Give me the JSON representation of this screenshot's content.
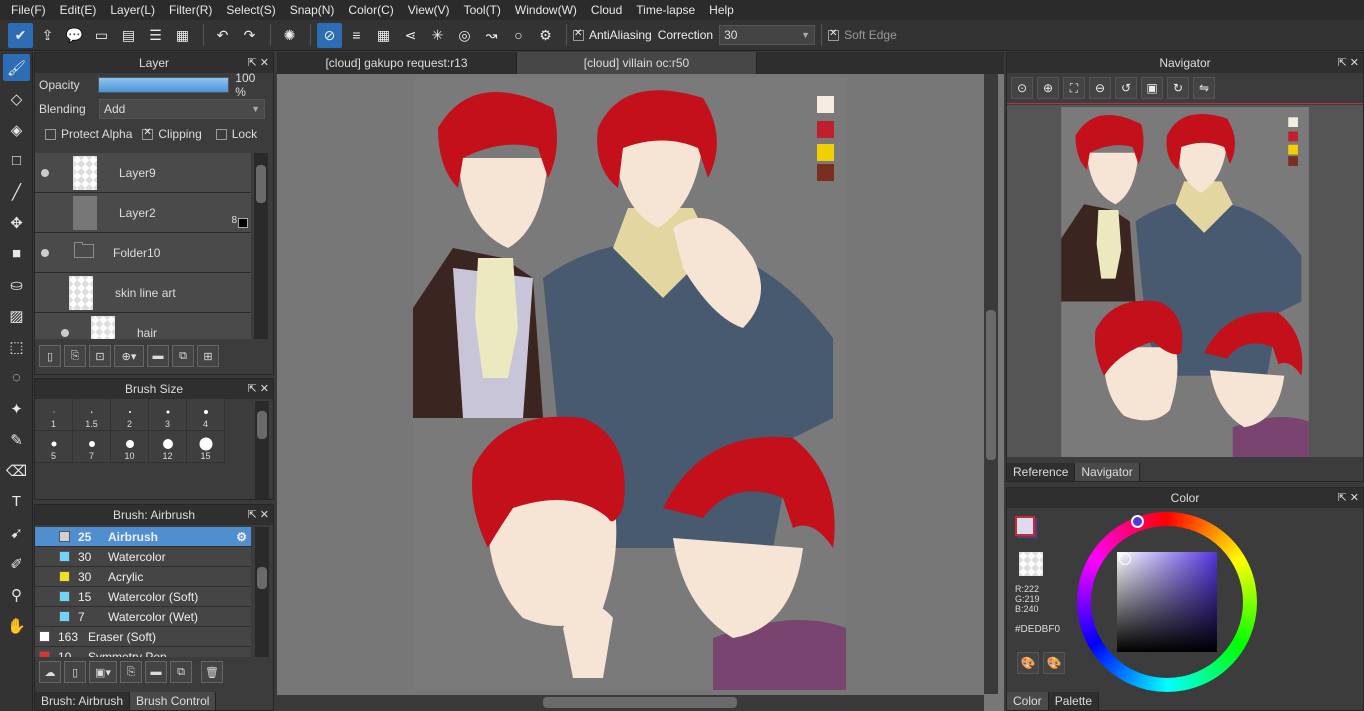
{
  "menu": [
    "File(F)",
    "Edit(E)",
    "Layer(L)",
    "Filter(R)",
    "Select(S)",
    "Snap(N)",
    "Color(C)",
    "View(V)",
    "Tool(T)",
    "Window(W)",
    "Cloud",
    "Time-lapse",
    "Help"
  ],
  "toolbar": {
    "antialiasing_label": "AntiAliasing",
    "correction_label": "Correction",
    "correction_value": "30",
    "soft_edge_label": "Soft Edge"
  },
  "layer_panel": {
    "title": "Layer",
    "opacity_label": "Opacity",
    "opacity_value": "100 %",
    "opacity_fraction": 1.0,
    "blending_label": "Blending",
    "blending_value": "Add",
    "protect_alpha": "Protect Alpha",
    "clipping": "Clipping",
    "lock": "Lock",
    "layers": [
      {
        "name": "Layer9"
      },
      {
        "name": "Layer2",
        "badge": "8"
      },
      {
        "name": "Folder10"
      },
      {
        "name": "skin line art"
      },
      {
        "name": "hair"
      }
    ]
  },
  "brush_size_panel": {
    "title": "Brush Size",
    "sizes": [
      "1",
      "1.5",
      "2",
      "3",
      "4",
      "5",
      "7",
      "10",
      "12",
      "15"
    ]
  },
  "brush_panel": {
    "title": "Brush: Airbrush",
    "brushes": [
      {
        "size": "25",
        "name": "Airbrush",
        "color": "#d0d0d0"
      },
      {
        "size": "30",
        "name": "Watercolor",
        "color": "#6fd4f5"
      },
      {
        "size": "30",
        "name": "Acrylic",
        "color": "#f0e020"
      },
      {
        "size": "15",
        "name": "Watercolor (Soft)",
        "color": "#6fd4f5"
      },
      {
        "size": "7",
        "name": "Watercolor (Wet)",
        "color": "#6fd4f5"
      },
      {
        "size": "163",
        "name": "Eraser (Soft)",
        "color": "#ffffff"
      },
      {
        "size": "10",
        "name": "Symmetry Pen",
        "color": "#e03030"
      }
    ],
    "bottom_tabs": [
      "Brush: Airbrush",
      "Brush Control"
    ]
  },
  "document_tabs": [
    "[cloud] gakupo request:r13",
    "[cloud] villain oc:r50"
  ],
  "palette_swatches": [
    "#f6ece2",
    "#c0202e",
    "#f0d000",
    "#7a2e20"
  ],
  "navigator": {
    "title": "Navigator",
    "tabs": [
      "Reference",
      "Navigator"
    ]
  },
  "color_panel": {
    "title": "Color",
    "r": "R:222",
    "g": "G:219",
    "b": "B:240",
    "hex": "#DEDBF0",
    "tabs": [
      "Color",
      "Palette"
    ]
  }
}
